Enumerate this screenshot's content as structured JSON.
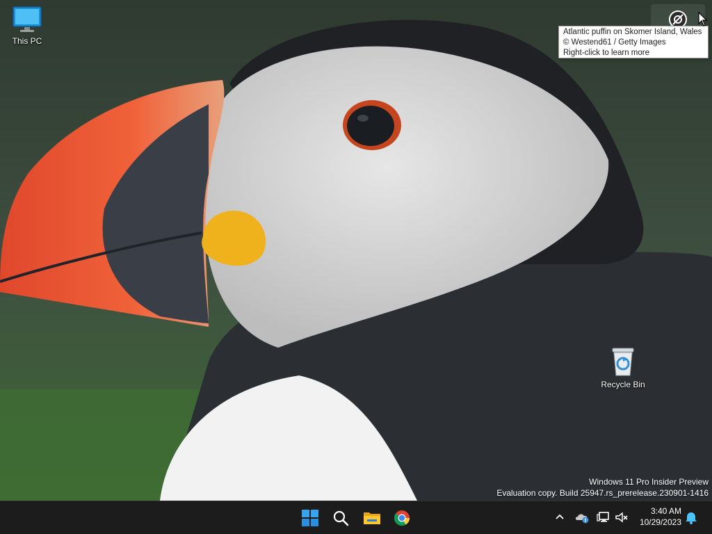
{
  "desktop": {
    "icons": [
      {
        "label": "This PC"
      },
      {
        "label": "Recycle Bin"
      }
    ],
    "wallpaper_subject": "Atlantic puffin close-up"
  },
  "tooltip": {
    "line1": "Atlantic puffin on Skomer Island, Wales",
    "line2": "© Westend61 / Getty Images",
    "line3": "Right-click to learn more"
  },
  "watermark": {
    "line1": "Windows 11 Pro Insider Preview",
    "line2": "Evaluation copy. Build 25947.rs_prerelease.230901-1416"
  },
  "taskbar": {
    "pinned": [
      {
        "icon": "windows-start-icon"
      },
      {
        "icon": "search-icon"
      },
      {
        "icon": "file-explorer-icon"
      },
      {
        "icon": "chrome-icon"
      }
    ],
    "tray": {
      "icons": [
        "chevron-up-icon",
        "onedrive-icon",
        "network-icon",
        "volume-muted-icon",
        "notification-bell-icon"
      ],
      "time": "3:40 AM",
      "date": "10/29/2023"
    }
  },
  "colors": {
    "taskbar_bg": "#1c1c1c",
    "accent": "#0078d4",
    "notification": "#4cc2ff"
  }
}
